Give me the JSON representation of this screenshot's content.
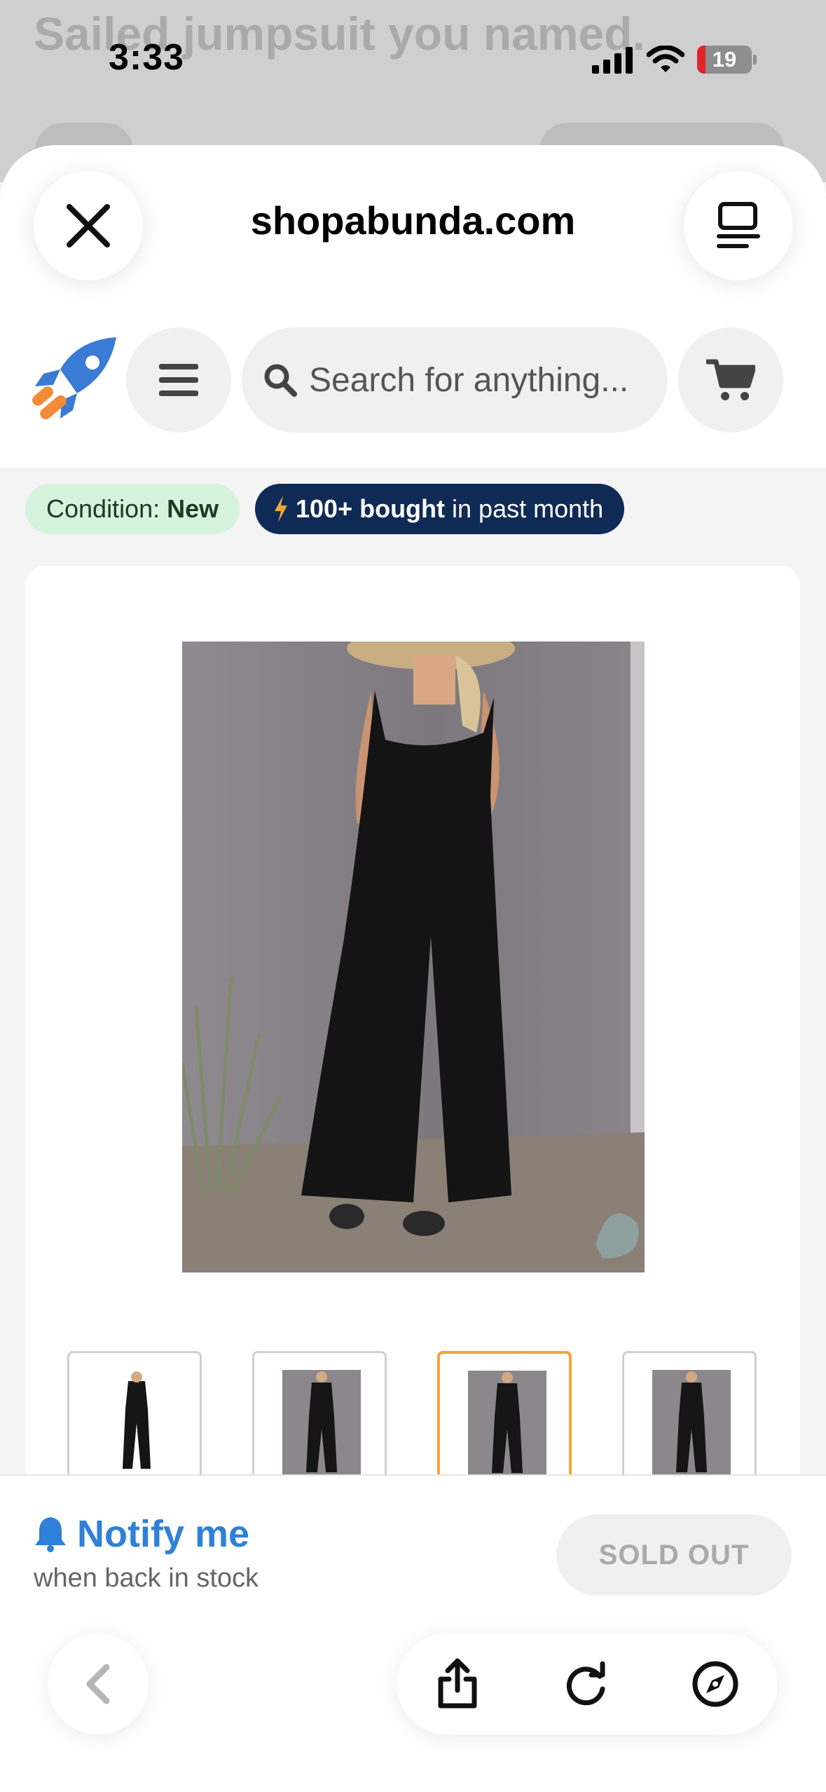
{
  "background_page": {
    "title": "Sailed jumpsuit you named."
  },
  "status_bar": {
    "time": "3:33",
    "battery": "19"
  },
  "sheet": {
    "site_title": "shopabunda.com"
  },
  "site_nav": {
    "search_placeholder": "Search for anything..."
  },
  "badges": {
    "condition_label": "Condition:",
    "condition_value": "New",
    "bought_bold": "100+ bought",
    "bought_rest": "in past month"
  },
  "product": {
    "thumbnails": [
      {
        "name": "thumbnail-1",
        "selected": false
      },
      {
        "name": "thumbnail-2",
        "selected": false
      },
      {
        "name": "thumbnail-3",
        "selected": true
      },
      {
        "name": "thumbnail-4",
        "selected": false
      }
    ]
  },
  "bottom": {
    "notify_label": "Notify me",
    "notify_sub": "when back in stock",
    "sold_out_label": "SOLD OUT"
  },
  "colors": {
    "accent_blue": "#2f80d8",
    "bought_badge_bg": "#102a56",
    "condition_badge_bg": "#d6f3dc",
    "selected_thumb_border": "#f0a73a",
    "rocket_blue": "#3a7bd5",
    "rocket_orange": "#f28c38"
  }
}
